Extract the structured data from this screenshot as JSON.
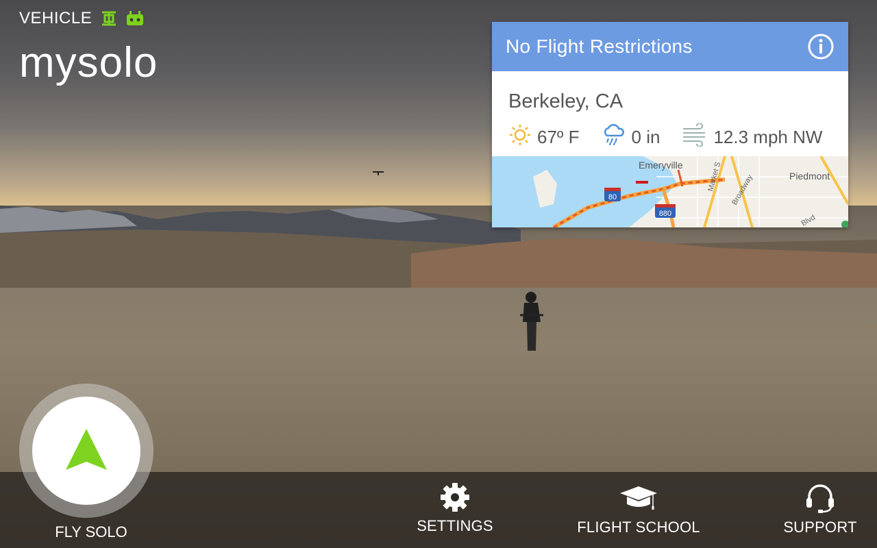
{
  "status": {
    "label": "VEHICLE",
    "drone_icon": "drone-icon",
    "controller_icon": "controller-icon",
    "icon_color": "#7ed321"
  },
  "brand": {
    "name": "mysolo"
  },
  "flight_card": {
    "title": "No Flight Restrictions",
    "header_color": "#6d9be2",
    "info_icon": "info-icon",
    "location": "Berkeley, CA",
    "weather": {
      "temperature": "67º F",
      "precipitation": "0 in",
      "wind": "12.3 mph NW",
      "sun_icon": "sun-icon",
      "rain_icon": "rain-cloud-icon",
      "wind_icon": "wind-icon"
    },
    "map": {
      "labels": {
        "emeryville": "Emeryville",
        "piedmont": "Piedmont",
        "market": "Market S",
        "broadway": "Broadway",
        "blvd": "Blvd"
      },
      "shields": {
        "i80": "80",
        "i880": "880"
      }
    }
  },
  "fly_button": {
    "label": "FLY SOLO",
    "icon": "navigation-arrow-icon",
    "accent": "#7ed321"
  },
  "nav": {
    "settings": {
      "label": "SETTINGS",
      "icon": "gear-icon"
    },
    "flight_school": {
      "label": "FLIGHT SCHOOL",
      "icon": "graduation-cap-icon"
    },
    "support": {
      "label": "SUPPORT",
      "icon": "headset-icon"
    }
  }
}
